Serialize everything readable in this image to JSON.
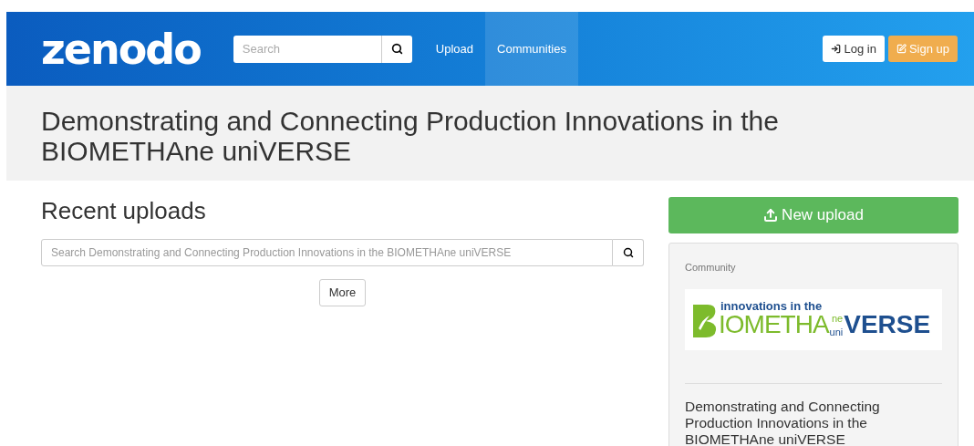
{
  "header": {
    "logo": "zenodo",
    "search": {
      "placeholder": "Search"
    },
    "nav": [
      {
        "label": "Upload",
        "selected": false
      },
      {
        "label": "Communities",
        "selected": true
      }
    ],
    "login": "Log in",
    "signup": "Sign up"
  },
  "title": "Demonstrating and Connecting Production Innovations in the BIOMETHAne uniVERSE",
  "recent": {
    "heading": "Recent uploads",
    "search": {
      "placeholder": "Search Demonstrating and Connecting Production Innovations in the BIOMETHAne uniVERSE"
    },
    "more": "More"
  },
  "sidebar": {
    "new_upload": "New upload",
    "label": "Community",
    "logo": {
      "top": "innovations in the",
      "main_rest": "IOMETHA",
      "sup": "ne",
      "sub": "uni",
      "end": "VERSE"
    },
    "name": "Demonstrating and Connecting Production Innovations in the BIOMETHAne uniVERSE"
  }
}
